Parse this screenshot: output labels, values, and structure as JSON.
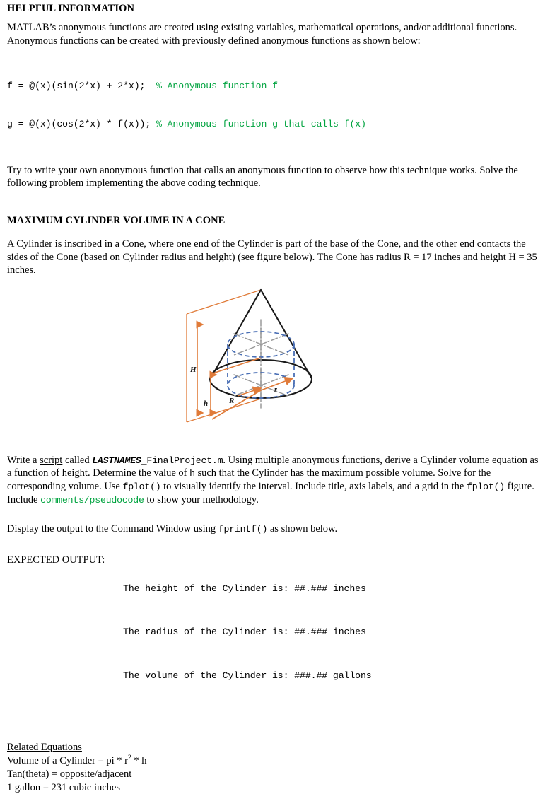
{
  "doc": {
    "sections": {
      "helpful_info": {
        "heading": "HELPFUL INFORMATION",
        "paragraph": "MATLAB’s anonymous functions are created using existing variables, mathematical operations, and/or additional functions.  Anonymous functions can be created with previously defined anonymous functions as shown below:",
        "code": {
          "line1_code": "f = @(x)(sin(2*x) + 2*x);  ",
          "line1_comment": "% Anonymous function f",
          "line2_code": "g = @(x)(cos(2*x) * f(x)); ",
          "line2_comment": "% Anonymous function g that calls f(x)"
        },
        "closing_paragraph": "Try to write your own anonymous function that calls an anonymous function to observe how this technique works.  Solve the following problem implementing the above coding technique."
      },
      "problem": {
        "heading": "MAXIMUM CYLINDER VOLUME IN A CONE",
        "paragraph": "A Cylinder is inscribed in a Cone, where one end of the Cylinder is part of the base of the Cone, and the other end contacts the sides of the Cone (based on Cylinder radius and height) (see figure below).  The Cone has radius R = 17 inches and height H = 35 inches."
      },
      "figure": {
        "caption_labels": {
          "cone_height": "H",
          "cylinder_height": "h",
          "cone_radius": "R",
          "cylinder_radius": "r"
        },
        "colors": {
          "cone_outline": "#1a1a1a",
          "cylinder_dashed": "#4a6fb5",
          "dimension_arrows": "#e07b39",
          "center_lines": "#9a9a9a"
        }
      },
      "instructions": {
        "part1_pre": "Write a ",
        "part1_underlined": "script",
        "part1_mid": " called ",
        "filename_bold_italic": "LASTNAMES",
        "filename_mono": "_FinalProject.m",
        "part2": ". Using multiple anonymous functions, derive a Cylinder volume equation as a function of height.  Determine the value of ",
        "var_h": "h",
        "part3": " such that the Cylinder has the maximum possible volume.  Solve for the corresponding volume.  Use ",
        "fplot1": "fplot()",
        "part4": " to visually identify the interval.  Include title, axis labels, and a grid in the ",
        "fplot2": "fplot()",
        "part5": " figure. Include ",
        "comments_word": "comments",
        "slash": "/",
        "pseudocode_word": "pseudocode",
        "part6": " to show your methodology."
      },
      "display": {
        "pre": "Display the output to the Command Window using ",
        "fprintf": "fprintf()",
        "post": " as shown below."
      },
      "expected_output": {
        "label": "EXPECTED OUTPUT:",
        "lines": [
          "The height of the Cylinder is: ##.### inches",
          "The radius of the Cylinder is: ##.### inches",
          "The volume of the Cylinder is: ###.## gallons"
        ]
      },
      "related_equations": {
        "title": "Related Equations",
        "line1_pre": "Volume of a Cylinder = pi * r",
        "line1_sup": "2",
        "line1_post": " * h",
        "line2": "Tan(theta) = opposite/adjacent",
        "line3": "1 gallon = 231 cubic inches"
      }
    }
  }
}
